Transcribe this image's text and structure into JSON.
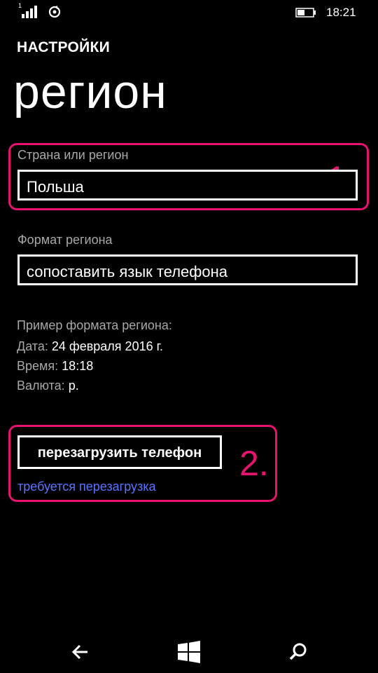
{
  "status_bar": {
    "sim_label": "1",
    "time": "18:21",
    "icons": [
      "signal-icon",
      "sync-icon",
      "battery-icon"
    ]
  },
  "header": {
    "app_title": "НАСТРОЙКИ",
    "page_title": "регион"
  },
  "country": {
    "label": "Страна или регион",
    "value": "Польша"
  },
  "region_format": {
    "label": "Формат региона",
    "value": "сопоставить язык телефона"
  },
  "example": {
    "heading": "Пример формата региона:",
    "date_label": "Дата:",
    "date_value": "24  февраля 2016 г.",
    "time_label": "Время:",
    "time_value": "18:18",
    "currency_label": "Валюта:",
    "currency_value": "р."
  },
  "restart": {
    "button_label": "перезагрузить телефон",
    "note": "требуется перезагрузка"
  },
  "annotations": {
    "first": "1.",
    "second": "2.",
    "color": "#e6146f"
  },
  "nav_bar": {
    "icons": [
      "back-arrow-icon",
      "windows-start-icon",
      "search-icon"
    ]
  },
  "colors": {
    "background": "#000000",
    "text": "#ffffff",
    "label": "#a8a8a8",
    "link": "#5a74ff",
    "highlight": "#e6146f"
  }
}
